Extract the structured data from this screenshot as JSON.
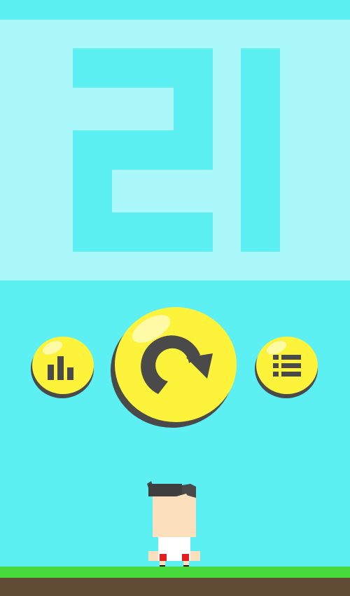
{
  "game": {
    "score": "21",
    "colors": {
      "sky": "#5cf0f2",
      "score_panel": "#aaf8f9",
      "score_digits": "#5cf0f2",
      "button_yellow": "#fdf33a",
      "icon_dark": "#4a4a4a",
      "grass": "#47d93c",
      "dirt": "#5f4b33"
    }
  },
  "buttons": {
    "stats": {
      "icon": "bar-chart-icon"
    },
    "replay": {
      "icon": "replay-arrow-icon"
    },
    "menu": {
      "icon": "list-icon"
    }
  },
  "player": {
    "character": "blocky-boy-character"
  }
}
